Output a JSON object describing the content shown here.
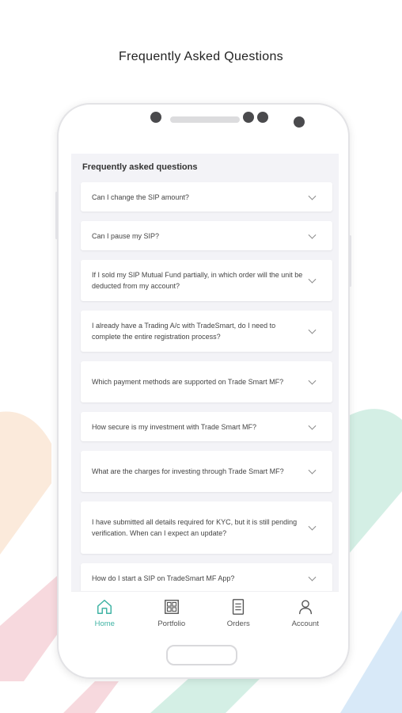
{
  "promo": {
    "title": "Frequently Asked Questions"
  },
  "screen": {
    "header": "Frequently asked questions",
    "faqs": [
      "Can I change the SIP amount?",
      "Can I pause my SIP?",
      "If I sold my SIP Mutual Fund partially, in which order will the unit be deducted from my account?",
      "I already have a Trading A/c with TradeSmart, do I need to complete the entire registration process?",
      "Which payment methods are supported on Trade Smart MF?",
      "How secure is my investment with Trade Smart MF?",
      "What are the charges for investing through Trade Smart MF?",
      "I have submitted all details required for KYC, but it is still pending verification. When can I expect an update?",
      "How do I start a SIP on TradeSmart MF App?"
    ]
  },
  "nav": {
    "items": [
      {
        "label": "Home",
        "icon": "home-icon",
        "active": true
      },
      {
        "label": "Portfolio",
        "icon": "portfolio-icon",
        "active": false
      },
      {
        "label": "Orders",
        "icon": "orders-icon",
        "active": false
      },
      {
        "label": "Account",
        "icon": "account-icon",
        "active": false
      }
    ]
  },
  "colors": {
    "accent": "#3fb3a4",
    "bg_peach": "#fbeadb",
    "bg_pink": "#f7d9de",
    "bg_mint": "#d4efe5",
    "bg_blue": "#d8e9f8"
  }
}
